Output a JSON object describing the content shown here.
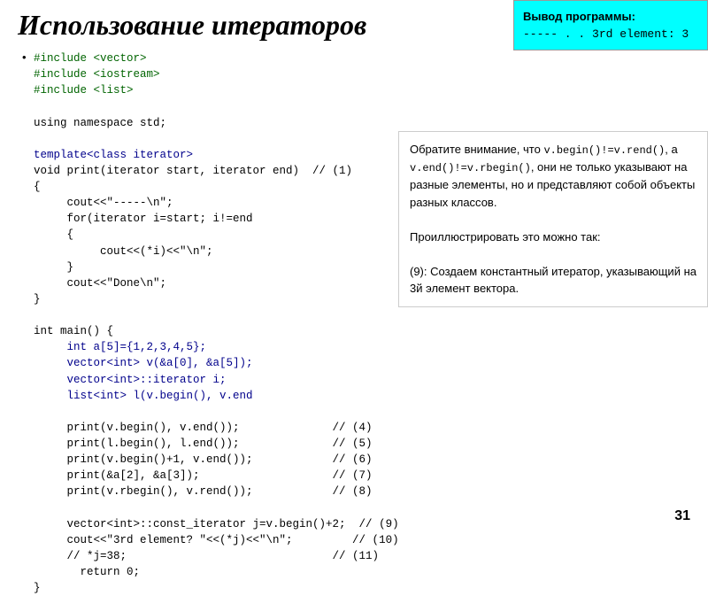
{
  "title": "Использование итераторов",
  "bullet": "•",
  "code": {
    "lines": [
      {
        "text": "#include <vector>",
        "color": "green"
      },
      {
        "text": "#include <iostream>",
        "color": "green"
      },
      {
        "text": "#include <list>",
        "color": "green"
      },
      {
        "text": "",
        "color": ""
      },
      {
        "text": "using namespace std;",
        "color": ""
      },
      {
        "text": "",
        "color": ""
      },
      {
        "text": "template<class iterator>",
        "color": "blue"
      },
      {
        "text": "void print(iterator start, iterator end)  // (1)",
        "color": ""
      },
      {
        "text": "{",
        "color": ""
      },
      {
        "text": "     cout<<\"-----\\n\";",
        "color": ""
      },
      {
        "text": "     for(iterator i=start; i!=end",
        "color": ""
      },
      {
        "text": "     {",
        "color": ""
      },
      {
        "text": "          cout<<(*i)<<\"\\n\";",
        "color": ""
      },
      {
        "text": "     }",
        "color": ""
      },
      {
        "text": "     cout<<\"Done\\n\";",
        "color": ""
      },
      {
        "text": "}",
        "color": ""
      },
      {
        "text": "",
        "color": ""
      },
      {
        "text": "int main() {",
        "color": ""
      },
      {
        "text": "     int a[5]={1,2,3,4,5};",
        "color": "blue"
      },
      {
        "text": "     vector<int> v(&a[0], &a[5]);",
        "color": "blue"
      },
      {
        "text": "     vector<int>::iterator i;",
        "color": "blue"
      },
      {
        "text": "     list<int> l(v.begin(), v.end",
        "color": "blue"
      },
      {
        "text": "",
        "color": ""
      },
      {
        "text": "     print(v.begin(), v.end());              // (4)",
        "color": ""
      },
      {
        "text": "     print(l.begin(), l.end());              // (5)",
        "color": ""
      },
      {
        "text": "     print(v.begin()+1, v.end());            // (6)",
        "color": ""
      },
      {
        "text": "     print(&a[2], &a[3]);                    // (7)",
        "color": ""
      },
      {
        "text": "     print(v.rbegin(), v.rend());            // (8)",
        "color": ""
      },
      {
        "text": "",
        "color": ""
      },
      {
        "text": "     vector<int>::const_iterator j=v.begin()+2;  // (9)",
        "color": ""
      },
      {
        "text": "     cout<<\"3rd element? \"<<(*j)<<\"\\n\";         // (10)",
        "color": ""
      },
      {
        "text": "     // *j=38;                               // (11)",
        "color": ""
      },
      {
        "text": "       return 0;",
        "color": ""
      },
      {
        "text": "}",
        "color": ""
      }
    ]
  },
  "output_box": {
    "title": "Вывод программы:",
    "lines": [
      "-----",
      ".",
      ".",
      "3rd element: 3"
    ]
  },
  "annotation": {
    "text1": "Обратите внимание, что v.begin()!=v.rend(), а v.end()!=v.rbegin(), они не только указывают на разные элементы, но и представляют собой объекты разных классов.",
    "text2": "Проиллюстрировать это можно так:",
    "text3": "(9): Создаем константный итератор, указывающий на 3й элемент вектора."
  },
  "page_number": "31"
}
